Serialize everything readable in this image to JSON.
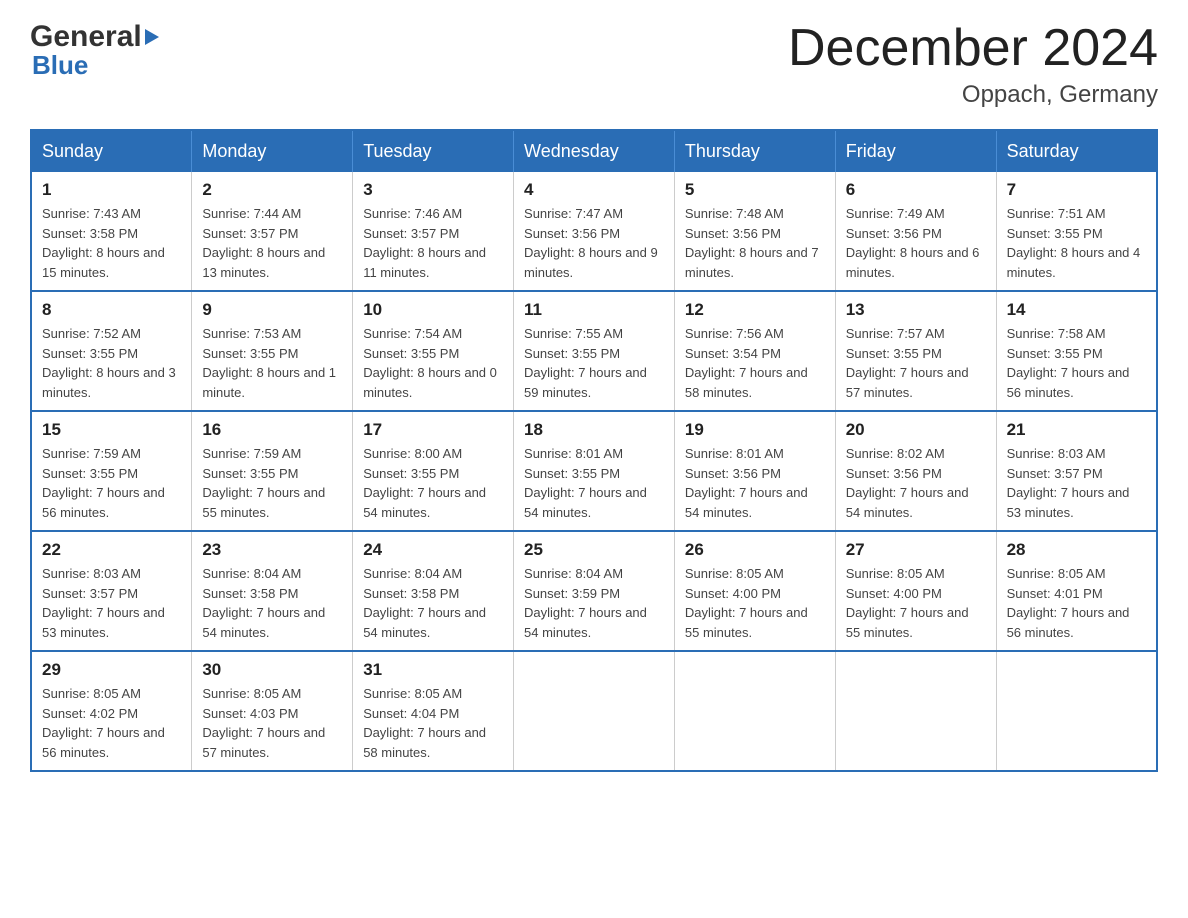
{
  "header": {
    "logo_general": "General",
    "logo_blue": "Blue",
    "month_title": "December 2024",
    "location": "Oppach, Germany"
  },
  "weekdays": [
    "Sunday",
    "Monday",
    "Tuesday",
    "Wednesday",
    "Thursday",
    "Friday",
    "Saturday"
  ],
  "weeks": [
    [
      {
        "day": "1",
        "sunrise": "7:43 AM",
        "sunset": "3:58 PM",
        "daylight": "8 hours and 15 minutes."
      },
      {
        "day": "2",
        "sunrise": "7:44 AM",
        "sunset": "3:57 PM",
        "daylight": "8 hours and 13 minutes."
      },
      {
        "day": "3",
        "sunrise": "7:46 AM",
        "sunset": "3:57 PM",
        "daylight": "8 hours and 11 minutes."
      },
      {
        "day": "4",
        "sunrise": "7:47 AM",
        "sunset": "3:56 PM",
        "daylight": "8 hours and 9 minutes."
      },
      {
        "day": "5",
        "sunrise": "7:48 AM",
        "sunset": "3:56 PM",
        "daylight": "8 hours and 7 minutes."
      },
      {
        "day": "6",
        "sunrise": "7:49 AM",
        "sunset": "3:56 PM",
        "daylight": "8 hours and 6 minutes."
      },
      {
        "day": "7",
        "sunrise": "7:51 AM",
        "sunset": "3:55 PM",
        "daylight": "8 hours and 4 minutes."
      }
    ],
    [
      {
        "day": "8",
        "sunrise": "7:52 AM",
        "sunset": "3:55 PM",
        "daylight": "8 hours and 3 minutes."
      },
      {
        "day": "9",
        "sunrise": "7:53 AM",
        "sunset": "3:55 PM",
        "daylight": "8 hours and 1 minute."
      },
      {
        "day": "10",
        "sunrise": "7:54 AM",
        "sunset": "3:55 PM",
        "daylight": "8 hours and 0 minutes."
      },
      {
        "day": "11",
        "sunrise": "7:55 AM",
        "sunset": "3:55 PM",
        "daylight": "7 hours and 59 minutes."
      },
      {
        "day": "12",
        "sunrise": "7:56 AM",
        "sunset": "3:54 PM",
        "daylight": "7 hours and 58 minutes."
      },
      {
        "day": "13",
        "sunrise": "7:57 AM",
        "sunset": "3:55 PM",
        "daylight": "7 hours and 57 minutes."
      },
      {
        "day": "14",
        "sunrise": "7:58 AM",
        "sunset": "3:55 PM",
        "daylight": "7 hours and 56 minutes."
      }
    ],
    [
      {
        "day": "15",
        "sunrise": "7:59 AM",
        "sunset": "3:55 PM",
        "daylight": "7 hours and 56 minutes."
      },
      {
        "day": "16",
        "sunrise": "7:59 AM",
        "sunset": "3:55 PM",
        "daylight": "7 hours and 55 minutes."
      },
      {
        "day": "17",
        "sunrise": "8:00 AM",
        "sunset": "3:55 PM",
        "daylight": "7 hours and 54 minutes."
      },
      {
        "day": "18",
        "sunrise": "8:01 AM",
        "sunset": "3:55 PM",
        "daylight": "7 hours and 54 minutes."
      },
      {
        "day": "19",
        "sunrise": "8:01 AM",
        "sunset": "3:56 PM",
        "daylight": "7 hours and 54 minutes."
      },
      {
        "day": "20",
        "sunrise": "8:02 AM",
        "sunset": "3:56 PM",
        "daylight": "7 hours and 54 minutes."
      },
      {
        "day": "21",
        "sunrise": "8:03 AM",
        "sunset": "3:57 PM",
        "daylight": "7 hours and 53 minutes."
      }
    ],
    [
      {
        "day": "22",
        "sunrise": "8:03 AM",
        "sunset": "3:57 PM",
        "daylight": "7 hours and 53 minutes."
      },
      {
        "day": "23",
        "sunrise": "8:04 AM",
        "sunset": "3:58 PM",
        "daylight": "7 hours and 54 minutes."
      },
      {
        "day": "24",
        "sunrise": "8:04 AM",
        "sunset": "3:58 PM",
        "daylight": "7 hours and 54 minutes."
      },
      {
        "day": "25",
        "sunrise": "8:04 AM",
        "sunset": "3:59 PM",
        "daylight": "7 hours and 54 minutes."
      },
      {
        "day": "26",
        "sunrise": "8:05 AM",
        "sunset": "4:00 PM",
        "daylight": "7 hours and 55 minutes."
      },
      {
        "day": "27",
        "sunrise": "8:05 AM",
        "sunset": "4:00 PM",
        "daylight": "7 hours and 55 minutes."
      },
      {
        "day": "28",
        "sunrise": "8:05 AM",
        "sunset": "4:01 PM",
        "daylight": "7 hours and 56 minutes."
      }
    ],
    [
      {
        "day": "29",
        "sunrise": "8:05 AM",
        "sunset": "4:02 PM",
        "daylight": "7 hours and 56 minutes."
      },
      {
        "day": "30",
        "sunrise": "8:05 AM",
        "sunset": "4:03 PM",
        "daylight": "7 hours and 57 minutes."
      },
      {
        "day": "31",
        "sunrise": "8:05 AM",
        "sunset": "4:04 PM",
        "daylight": "7 hours and 58 minutes."
      },
      null,
      null,
      null,
      null
    ]
  ],
  "labels": {
    "sunrise": "Sunrise:",
    "sunset": "Sunset:",
    "daylight": "Daylight:"
  }
}
